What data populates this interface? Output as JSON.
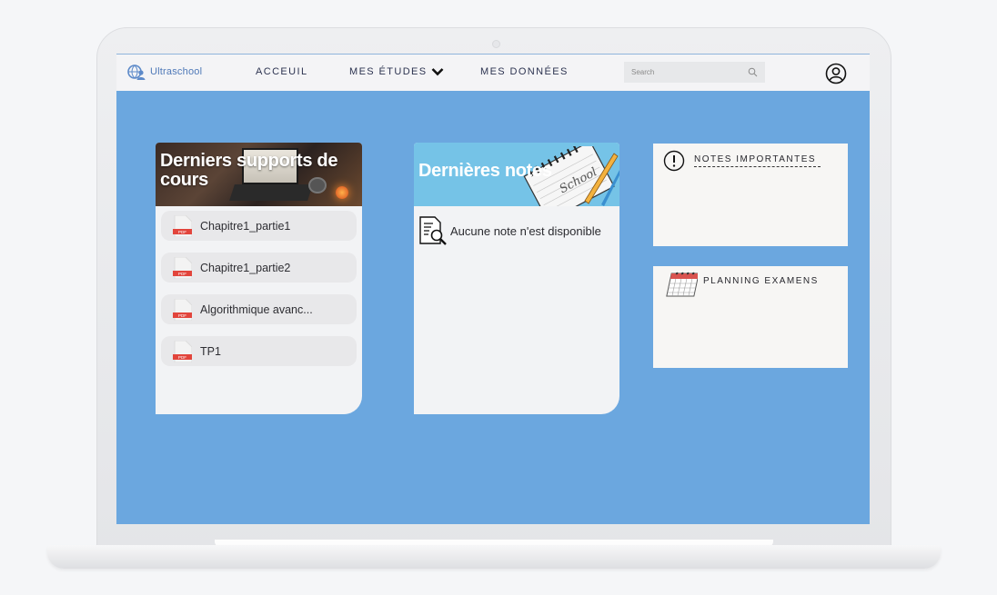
{
  "brand": {
    "name": "Ultraschool",
    "accent": "#4f79b8"
  },
  "nav": {
    "links": [
      "ACCEUIL",
      "MES ÉTUDES",
      "MES DONNÉES"
    ],
    "search_placeholder": "Search"
  },
  "cards": {
    "supports": {
      "title": "Derniers supports de cours",
      "files": [
        "Chapitre1_partie1",
        "Chapitre1_partie2",
        "Algorithmique avanc...",
        "TP1"
      ],
      "file_icon": "pdf-icon"
    },
    "notes": {
      "title": "Dernières notes",
      "empty_message": "Aucune note n'est disponible"
    },
    "important": {
      "title": "NOTES IMPORTANTES"
    },
    "exams": {
      "title": "PLANNING EXAMENS"
    }
  },
  "colors": {
    "screen_background": "#6ba7df",
    "card_background": "#f2f3f5",
    "notes_header": "#75c3e7"
  }
}
